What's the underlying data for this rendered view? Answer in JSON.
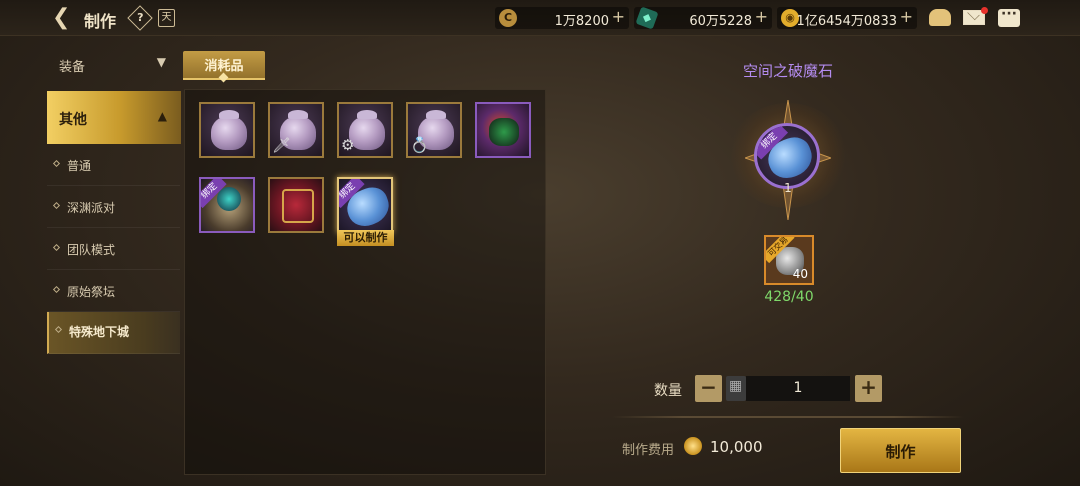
{
  "header": {
    "title": "制作",
    "help_icon": "question-diamond-icon",
    "book_icon": "book-icon",
    "currencies": [
      {
        "name": "silver",
        "icon": "currency-c-icon",
        "value": "1万8200",
        "color": "#d9b56a"
      },
      {
        "name": "gem",
        "icon": "green-crystal-icon",
        "value": "60万5228",
        "color": "#34c9a0"
      },
      {
        "name": "gold",
        "icon": "gold-coin-icon",
        "value": "1亿6454万0833",
        "color": "#e7b53a"
      }
    ],
    "plus_label": "+"
  },
  "sidebar": {
    "top_category": "装备",
    "active_category": "其他",
    "items": [
      {
        "label": "普通"
      },
      {
        "label": "深渊派对"
      },
      {
        "label": "团队模式"
      },
      {
        "label": "原始祭坛"
      },
      {
        "label": "特殊地下城"
      }
    ],
    "selected_index": 4
  },
  "tabs": {
    "active": "消耗品"
  },
  "grid": {
    "slots": [
      {
        "type": "pot",
        "tool": ""
      },
      {
        "type": "pot",
        "tool": "🗡"
      },
      {
        "type": "pot",
        "tool": "⚙"
      },
      {
        "type": "pot",
        "tool": "💍"
      },
      {
        "type": "jester"
      },
      {
        "type": "scroll",
        "bind": "绑定"
      },
      {
        "type": "chest"
      },
      {
        "type": "gem",
        "bind": "绑定"
      }
    ],
    "selected_badge": "可以制作"
  },
  "detail": {
    "item_name": "空间之破魔石",
    "bind_tag": "绑定",
    "result_count": "1",
    "material_tag": "可交易",
    "material_count": "40",
    "material_have": "428/40",
    "quantity_label": "数量",
    "quantity_value": "1",
    "minus": "−",
    "plus": "+",
    "fee_label": "制作费用",
    "fee_value": "10,000",
    "make_label": "制作"
  }
}
